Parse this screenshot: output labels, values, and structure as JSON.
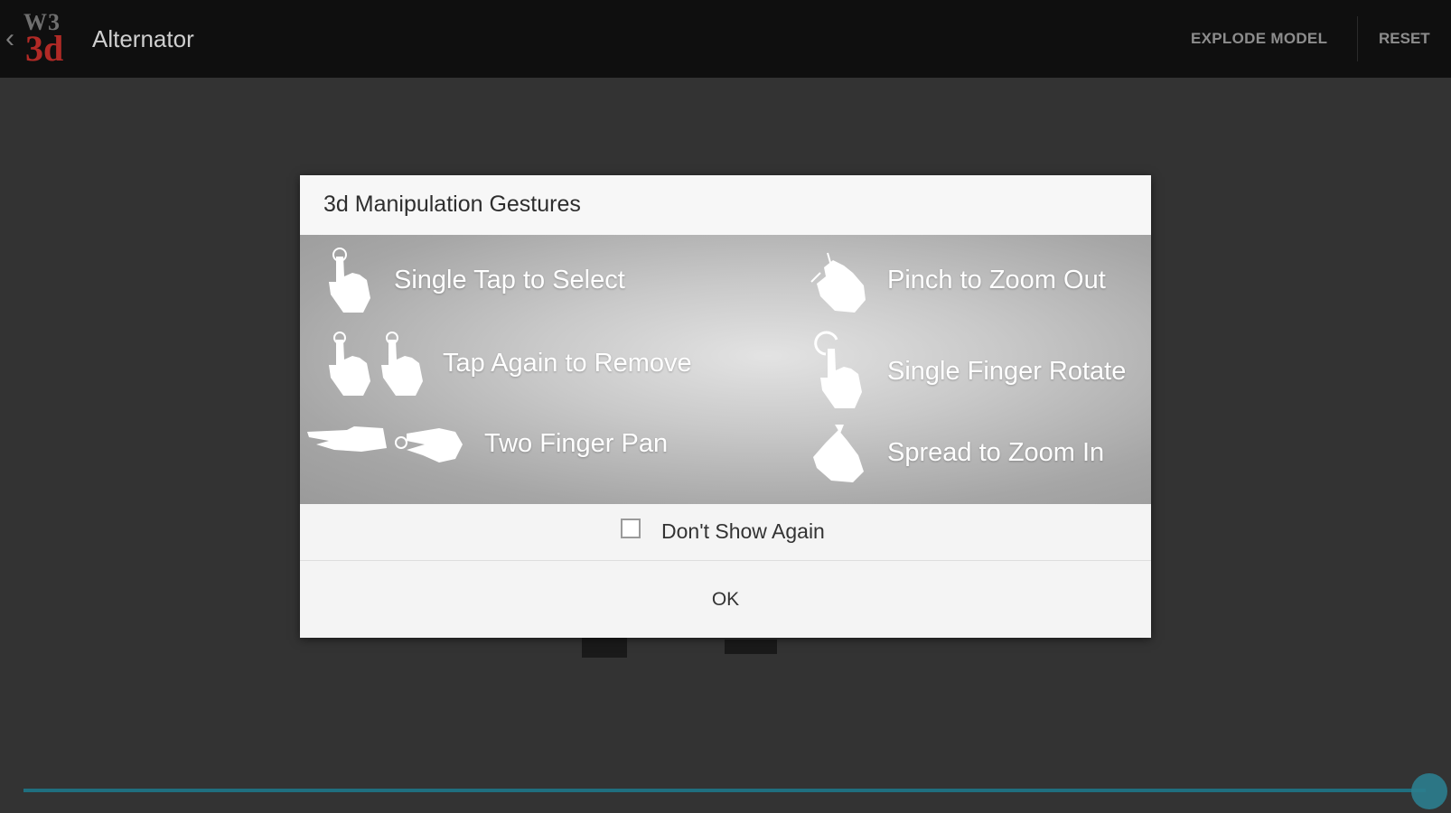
{
  "actionbar": {
    "back_icon": "chevron-left-icon",
    "logo_text_top": "W3",
    "logo_text_main": "3d",
    "title": "Alternator",
    "actions": {
      "explode": "EXPLODE MODEL",
      "reset": "RESET"
    }
  },
  "dialog": {
    "title": "3d Manipulation Gestures",
    "gestures": [
      {
        "icon": "single-tap-hand-icon",
        "label": "Single Tap to Select"
      },
      {
        "icon": "double-tap-hands-icon",
        "label": "Tap Again to Remove"
      },
      {
        "icon": "two-finger-pan-hands-icon",
        "label": "Two Finger Pan"
      },
      {
        "icon": "pinch-hand-icon",
        "label": "Pinch to Zoom Out"
      },
      {
        "icon": "rotate-hand-icon",
        "label": "Single Finger Rotate"
      },
      {
        "icon": "spread-hand-icon",
        "label": "Spread to Zoom In"
      }
    ],
    "dont_show_label": "Don't Show Again",
    "dont_show_checked": false,
    "ok_label": "OK"
  },
  "slider": {
    "value_percent": 100,
    "color": "#1f6f7f"
  },
  "colors": {
    "actionbar": "#0f0f0f",
    "background": "#333333",
    "logo_red": "#b12a26"
  }
}
